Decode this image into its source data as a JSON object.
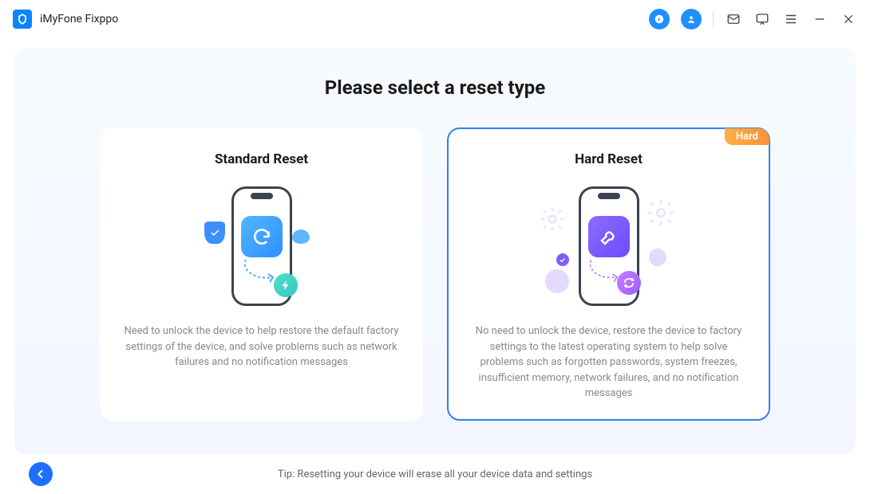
{
  "app": {
    "name": "iMyFone Fixppo"
  },
  "page": {
    "title": "Please select a reset type",
    "tip": "Tip: Resetting your device will erase all your device data and settings"
  },
  "cards": {
    "standard": {
      "title": "Standard Reset",
      "desc": "Need to unlock the device to help restore the default factory settings of the device, and solve problems such as network failures and no notification messages"
    },
    "hard": {
      "title": "Hard Reset",
      "badge": "Hard",
      "desc": "No need to unlock the device, restore the device to factory settings to the latest operating system to help solve problems such as forgotten passwords, system freezes, insufficient memory, network failures, and no notification messages"
    }
  }
}
